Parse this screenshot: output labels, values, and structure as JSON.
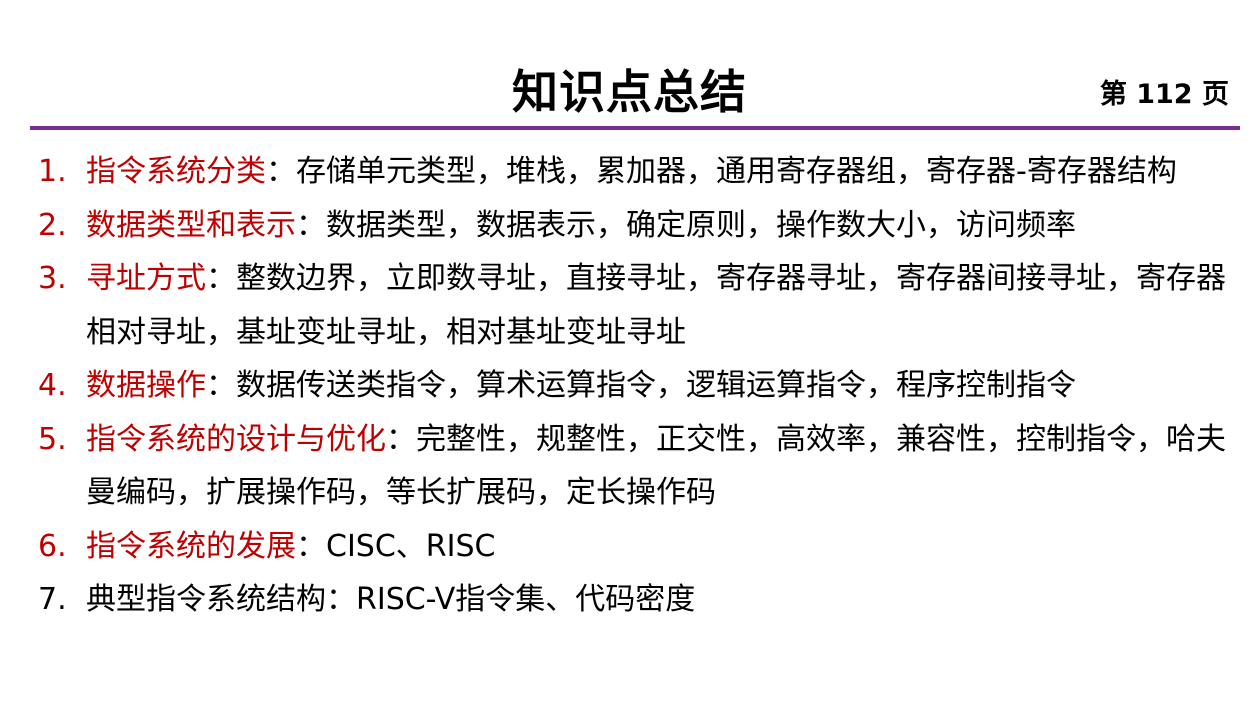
{
  "slide": {
    "title": "知识点总结",
    "page_label": "第 112 页",
    "accent_color": "#7a2e8c",
    "highlight_color": "#c00000"
  },
  "items": [
    {
      "number": "1.",
      "heading": "指令系统分类",
      "separator": "：",
      "text": "存储单元类型，堆栈，累加器，通用寄存器组，寄存器-寄存器结构",
      "highlighted": true
    },
    {
      "number": "2.",
      "heading": "数据类型和表示",
      "separator": "：",
      "text": "数据类型，数据表示，确定原则，操作数大小，访问频率",
      "highlighted": true
    },
    {
      "number": "3.",
      "heading": "寻址方式",
      "separator": "：",
      "text": "整数边界，立即数寻址，直接寻址，寄存器寻址，寄存器间接寻址，寄存器相对寻址，基址变址寻址，相对基址变址寻址",
      "highlighted": true
    },
    {
      "number": "4.",
      "heading": "数据操作",
      "separator": "：",
      "text": "数据传送类指令，算术运算指令，逻辑运算指令，程序控制指令",
      "highlighted": true
    },
    {
      "number": "5.",
      "heading": "指令系统的设计与优化",
      "separator": "：",
      "text": "完整性，规整性，正交性，高效率，兼容性，控制指令，哈夫曼编码，扩展操作码，等长扩展码，定长操作码",
      "highlighted": true
    },
    {
      "number": "6.",
      "heading": "指令系统的发展",
      "separator": "：",
      "text": "CISC、RISC",
      "highlighted": true
    },
    {
      "number": "7.",
      "heading": "典型指令系统结构",
      "separator": "：",
      "text": "RISC-V指令集、代码密度",
      "highlighted": false
    }
  ]
}
